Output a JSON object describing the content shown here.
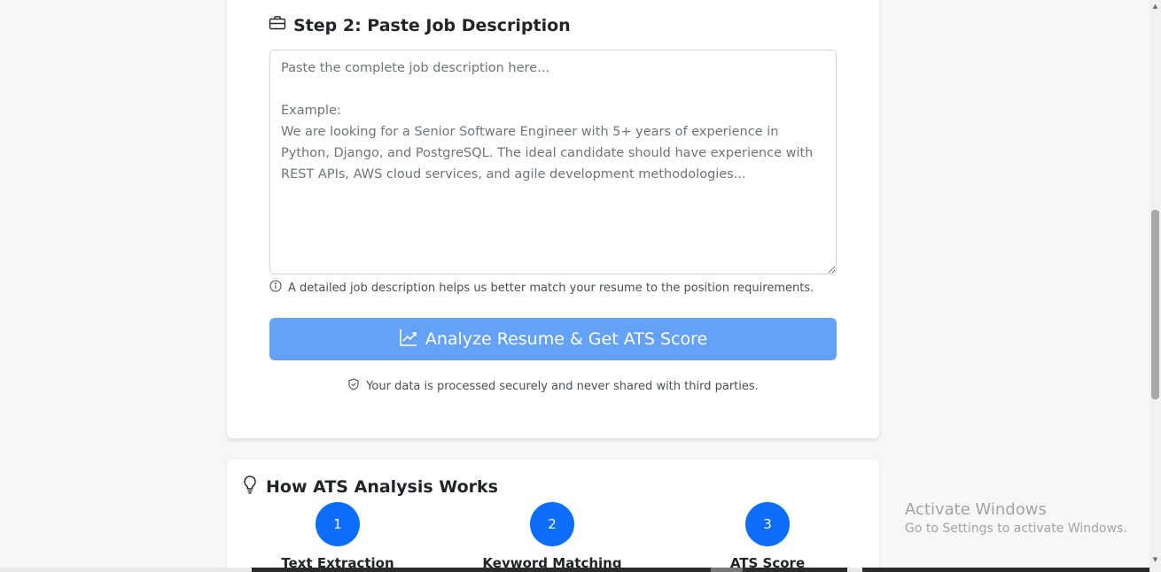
{
  "step2": {
    "title": "Step 2: Paste Job Description",
    "icon": "briefcase-icon",
    "textarea_placeholder": "Paste the complete job description here...\n\nExample:\nWe are looking for a Senior Software Engineer with 5+ years of experience in Python, Django, and PostgreSQL. The ideal candidate should have experience with REST APIs, AWS cloud services, and agile development methodologies...",
    "hint": "A detailed job description helps us better match your resume to the position requirements."
  },
  "analyze_button": {
    "label": "Analyze Resume & Get ATS Score",
    "color": "#64a2f7"
  },
  "secure_note": "Your data is processed securely and never shared with third parties.",
  "how_it_works": {
    "title": "How ATS Analysis Works",
    "steps": [
      {
        "number": "1",
        "label": "Text Extraction"
      },
      {
        "number": "2",
        "label": "Keyword Matching"
      },
      {
        "number": "3",
        "label": "ATS Score"
      }
    ],
    "accent": "#0d6efd"
  },
  "watermark": {
    "title": "Activate Windows",
    "subtitle": "Go to Settings to activate Windows."
  }
}
